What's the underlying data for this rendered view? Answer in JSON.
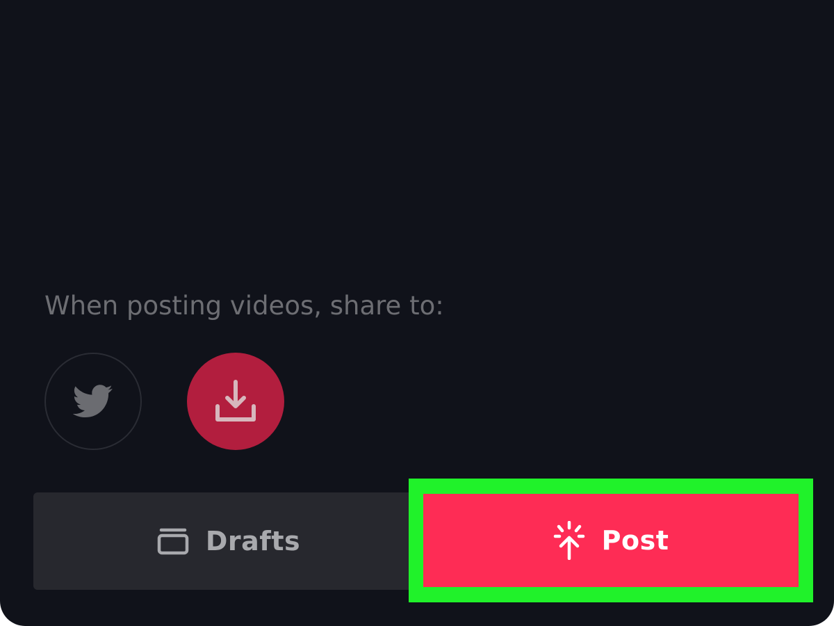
{
  "share": {
    "label": "When posting videos, share to:",
    "options": [
      {
        "name": "Twitter",
        "icon": "twitter-icon",
        "enabled": false
      },
      {
        "name": "Save to device",
        "icon": "download-icon",
        "enabled": true
      }
    ]
  },
  "actions": {
    "drafts": {
      "label": "Drafts",
      "icon": "drafts-icon"
    },
    "post": {
      "label": "Post",
      "icon": "post-upload-icon"
    }
  },
  "colors": {
    "background": "#10121a",
    "muted_text": "#6d6e73",
    "save_enabled": "#b21e3e",
    "drafts_bg": "#27282e",
    "post_bg": "#fe2c55",
    "highlight": "#20f22a"
  }
}
